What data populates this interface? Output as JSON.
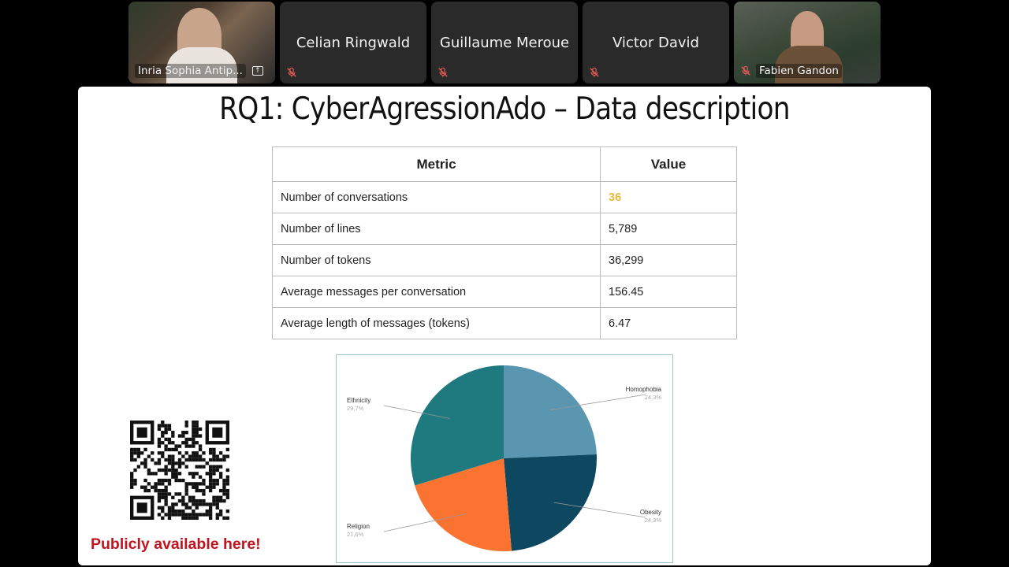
{
  "participants": [
    {
      "name": "Inria Sophia Antip...",
      "type": "video",
      "sharing": true
    },
    {
      "name": "Celian Ringwald",
      "type": "name",
      "muted": true
    },
    {
      "name": "Guillaume Meroue",
      "type": "name",
      "muted": true
    },
    {
      "name": "Victor David",
      "type": "name",
      "muted": true
    },
    {
      "name": "Fabien Gandon",
      "type": "video",
      "muted": true
    }
  ],
  "slide": {
    "title": "RQ1: CyberAgressionAdo – Data description",
    "table": {
      "headers": [
        "Metric",
        "Value"
      ],
      "rows": [
        [
          "Number of conversations",
          "36"
        ],
        [
          "Number of lines",
          "5,789"
        ],
        [
          "Number of tokens",
          "36,299"
        ],
        [
          "Average messages per conversation",
          "156.45"
        ],
        [
          "Average length of messages (tokens)",
          "6.47"
        ]
      ],
      "highlight_color": "#e8b83c"
    },
    "qr_caption": "Publicly available here!",
    "qr_caption_color": "#c0141e"
  },
  "chart_data": {
    "type": "pie",
    "categories": [
      "Homophobia",
      "Obesity",
      "Religion",
      "Ethnicity"
    ],
    "values": [
      24.3,
      24.3,
      21.6,
      29.7
    ],
    "value_labels": [
      "24,3%",
      "24,3%",
      "21,6%",
      "29,7%"
    ],
    "colors": [
      "#5a96b0",
      "#0e4760",
      "#fb7330",
      "#1f7a80"
    ],
    "title": ""
  }
}
